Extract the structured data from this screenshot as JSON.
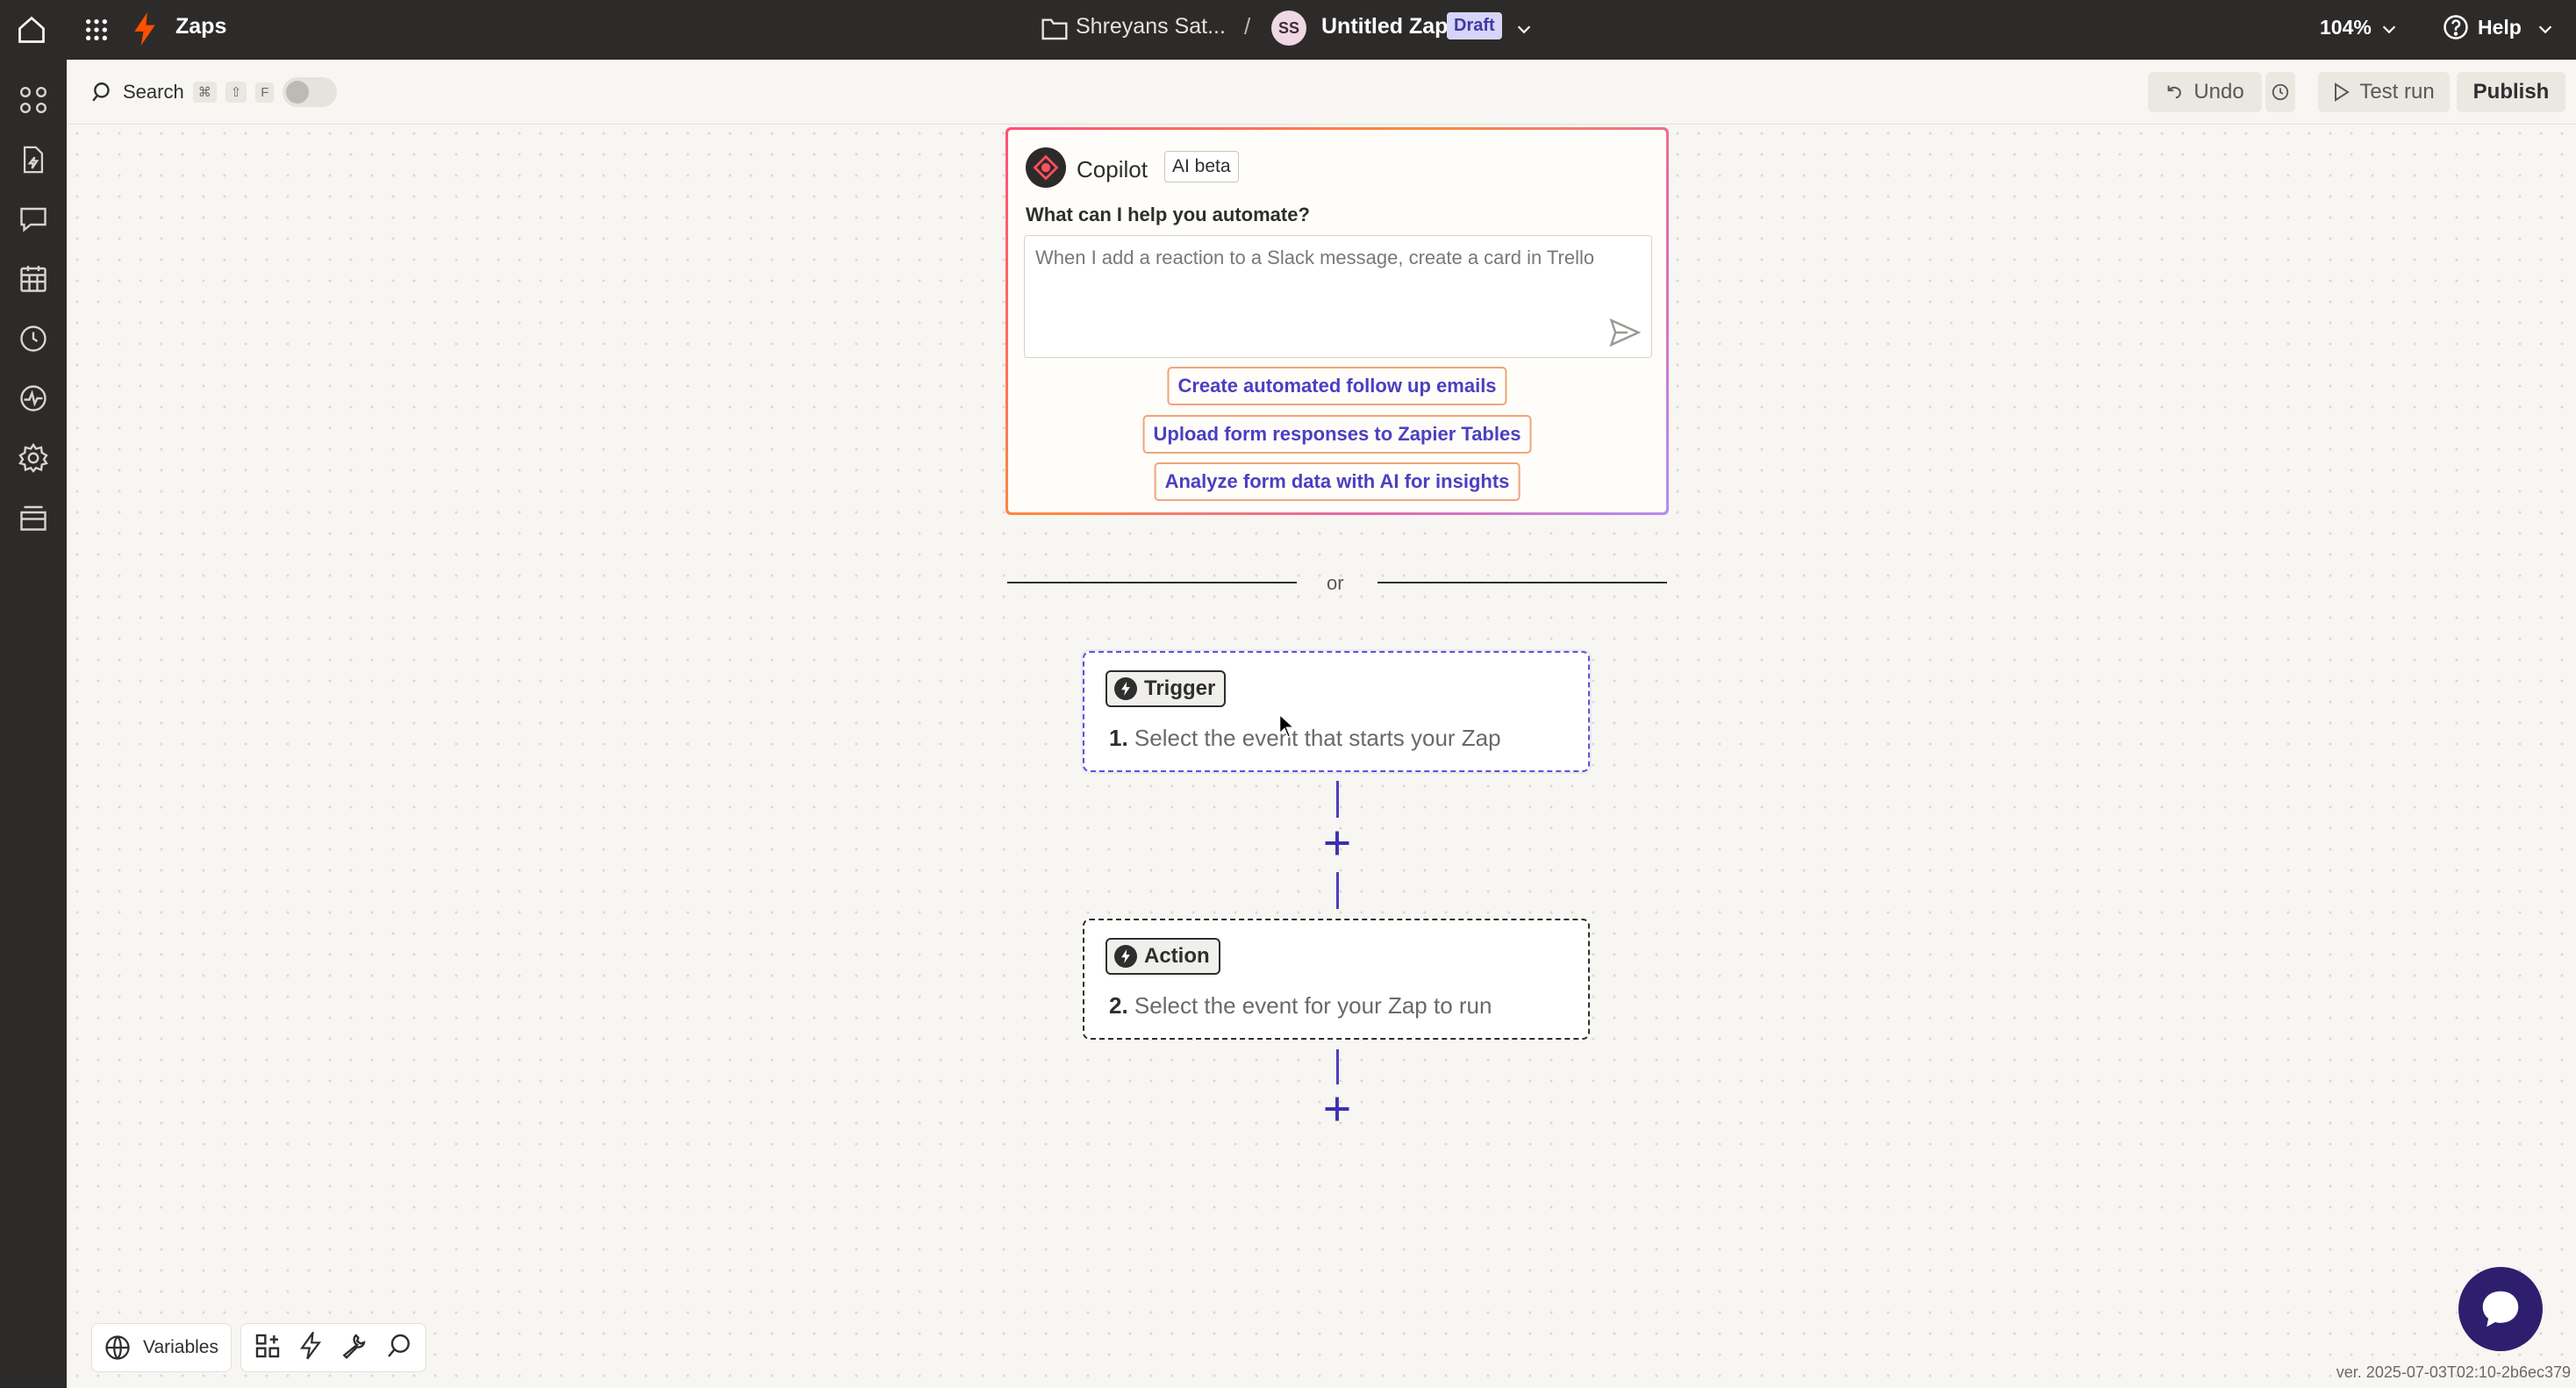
{
  "topbar": {
    "app_title": "Zaps",
    "folder": "Shreyans Sat...",
    "separator": "/",
    "avatar_initials": "SS",
    "zap_name": "Untitled Zap",
    "status_badge": "Draft",
    "zoom": "104%",
    "help": "Help"
  },
  "toolbar": {
    "search_label": "Search",
    "shortcut_keys": [
      "⌘",
      "⇧",
      "F"
    ],
    "undo_label": "Undo",
    "test_run_label": "Test run",
    "publish_label": "Publish"
  },
  "copilot": {
    "title": "Copilot",
    "badge": "AI beta",
    "question": "What can I help you automate?",
    "placeholder": "When I add a reaction to a Slack message, create a card in Trello",
    "suggestions": [
      "Create automated follow up emails",
      "Upload form responses to Zapier Tables",
      "Analyze form data with AI for insights"
    ]
  },
  "divider_text": "or",
  "steps": [
    {
      "badge": "Trigger",
      "number": "1.",
      "text": "Select the event that starts your Zap"
    },
    {
      "badge": "Action",
      "number": "2.",
      "text": "Select the event for your Zap to run"
    }
  ],
  "bottom_toolbar": {
    "variables_label": "Variables"
  },
  "version": "ver. 2025-07-03T02:10-2b6ec379",
  "colors": {
    "brand_orange": "#ff4f00",
    "accent_purple": "#4b3fc2",
    "topbar_bg": "#2d2b29"
  }
}
